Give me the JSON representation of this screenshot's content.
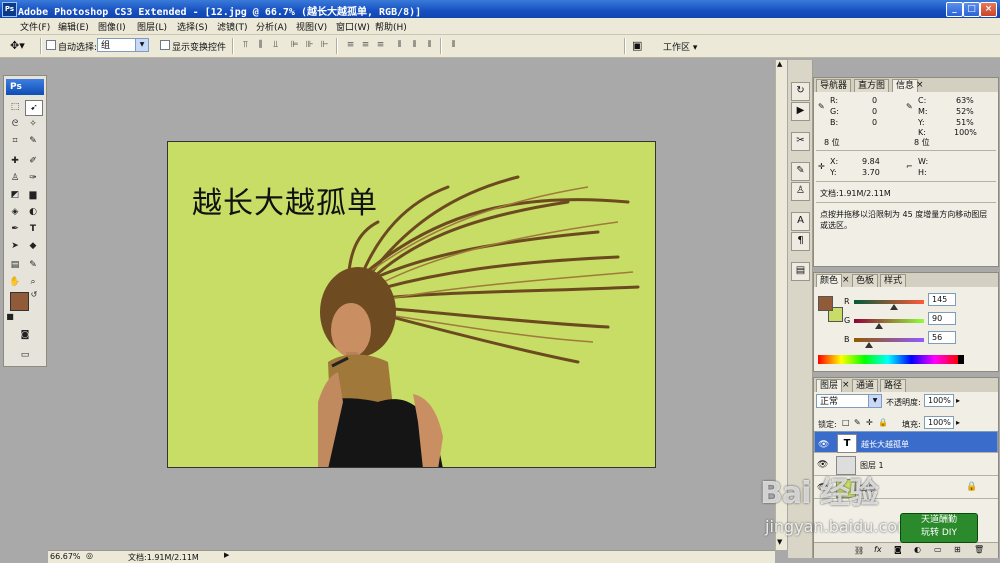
{
  "window": {
    "title": "Adobe Photoshop CS3 Extended - [12.jpg @ 66.7% (越长大越孤单, RGB/8)]",
    "app_icon_label": "Ps",
    "minimize": "_",
    "maximize": "□",
    "close": "×"
  },
  "menu": [
    "文件(F)",
    "编辑(E)",
    "图像(I)",
    "图层(L)",
    "选择(S)",
    "滤镜(T)",
    "分析(A)",
    "视图(V)",
    "窗口(W)",
    "帮助(H)"
  ],
  "options": {
    "auto_select_label": "自动选择:",
    "auto_select_value": "组",
    "show_transform_label": "显示变换控件",
    "workspace_label": "工作区 ▾"
  },
  "toolbox": {
    "header": "Ps"
  },
  "document": {
    "text_layer_content": "越长大越孤单",
    "canvas_color": "#c7dd66"
  },
  "status": {
    "zoom": "66.67%",
    "doc_size": "文档:1.91M/2.11M"
  },
  "info_panel": {
    "tabs": [
      "导航器",
      "直方图",
      "信息"
    ],
    "rgb": {
      "R": "0",
      "G": "0",
      "B": "0"
    },
    "cmyk": {
      "C": "63%",
      "M": "52%",
      "Y": "51%",
      "K": "100%"
    },
    "bits_left": "8 位",
    "bits_right": "8 位",
    "xy": {
      "X": "9.84",
      "Y": "3.70"
    },
    "wh": {
      "W": "",
      "H": ""
    },
    "doc_size": "文档:1.91M/2.11M",
    "hint": "点按并拖移以沿限制为 45 度增量方向移动图层或选区。"
  },
  "color_panel": {
    "tabs": [
      "颜色",
      "色板",
      "样式"
    ],
    "R": 145,
    "G": 90,
    "B": 56,
    "fg_color": "#915a38",
    "bg_color": "#c7dd66"
  },
  "layers_panel": {
    "tabs": [
      "图层",
      "通道",
      "路径"
    ],
    "blend_mode": "正常",
    "opacity_label": "不透明度:",
    "opacity": "100%",
    "lock_label": "锁定:",
    "fill_label": "填充:",
    "fill": "100%",
    "layers": [
      {
        "name": "越长大越孤单",
        "thumb": "T",
        "selected": true
      },
      {
        "name": "图层 1",
        "thumb": "",
        "selected": false
      },
      {
        "name": "背景",
        "thumb": "",
        "selected": false
      }
    ]
  },
  "watermark": {
    "brand": "Bai 经验",
    "url": "jingyan.baidu.com",
    "badge_line1": "天道酬勤",
    "badge_line2": "玩转 DIY"
  }
}
